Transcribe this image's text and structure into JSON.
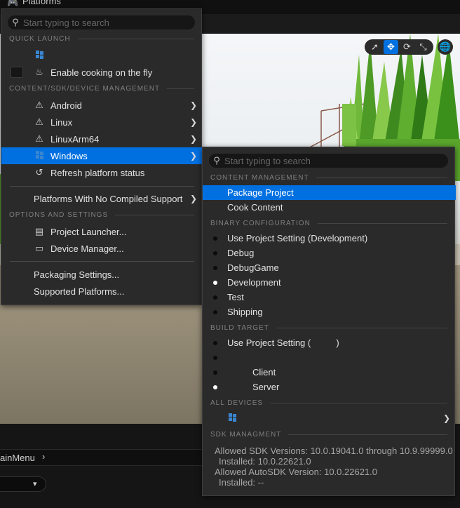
{
  "topbar": {
    "title": "Platforms",
    "icon": "platforms-icon"
  },
  "viewport": {
    "tools": [
      {
        "icon": "select-arrow-icon",
        "glyph": "➚",
        "active": false
      },
      {
        "icon": "move-icon",
        "glyph": "✥",
        "active": true
      },
      {
        "icon": "rotate-icon",
        "glyph": "⟳",
        "active": false
      },
      {
        "icon": "scale-icon",
        "glyph": "⤡",
        "active": false
      }
    ],
    "globe_icon": "globe-icon"
  },
  "bottom": {
    "breadcrumb": "ainMenu"
  },
  "left_menu": {
    "search_placeholder": "Start typing to search",
    "sections": {
      "quick_launch": "QUICK LAUNCH",
      "content_sdk": "CONTENT/SDK/DEVICE MANAGEMENT",
      "options": "OPTIONS AND SETTINGS"
    },
    "items": {
      "enable_cooking": "Enable cooking on the fly",
      "android": "Android",
      "linux": "Linux",
      "linuxarm64": "LinuxArm64",
      "windows": "Windows",
      "refresh": "Refresh platform status",
      "no_compiled": "Platforms With No Compiled Support",
      "project_launcher": "Project Launcher...",
      "device_manager": "Device Manager...",
      "packaging_settings": "Packaging Settings...",
      "supported_platforms": "Supported Platforms..."
    }
  },
  "right_menu": {
    "search_placeholder": "Start typing to search",
    "sections": {
      "content": "CONTENT MANAGEMENT",
      "binary": "BINARY CONFIGURATION",
      "build": "BUILD TARGET",
      "devices": "ALL DEVICES",
      "sdk": "SDK MANAGMENT"
    },
    "items": {
      "package_project": "Package Project",
      "cook_content": "Cook Content",
      "use_project_setting_dev": "Use Project Setting (Development)",
      "debug": "Debug",
      "debuggame": "DebugGame",
      "development": "Development",
      "test": "Test",
      "shipping": "Shipping",
      "use_project_setting_target": "Use Project Setting (          )",
      "client": "Client",
      "server": "Server"
    },
    "sdk_info": {
      "allowed_sdk": "Allowed SDK Versions: 10.0.19041.0 through 10.9.99999.0",
      "installed_sdk": "Installed: 10.0.22621.0",
      "allowed_autosdk": "Allowed AutoSDK Version: 10.0.22621.0",
      "installed_autosdk": "Installed: --"
    }
  }
}
